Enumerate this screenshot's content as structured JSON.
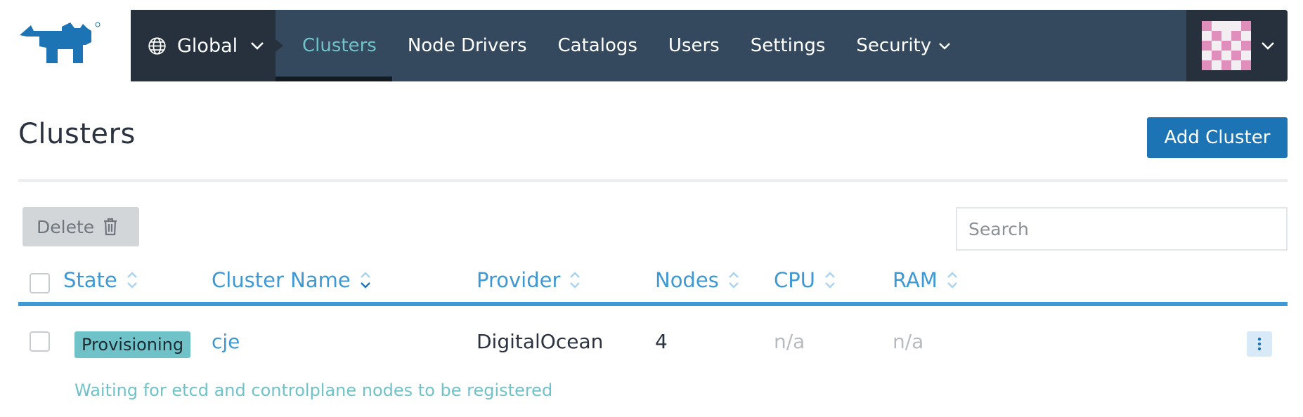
{
  "brand": {
    "logo_icon": "rancher-cow-logo",
    "logo_color": "#1d74b5"
  },
  "nav": {
    "scope_label": "Global",
    "items": [
      {
        "label": "Clusters",
        "active": true
      },
      {
        "label": "Node Drivers"
      },
      {
        "label": "Catalogs"
      },
      {
        "label": "Users"
      },
      {
        "label": "Settings"
      },
      {
        "label": "Security",
        "has_dropdown": true
      }
    ]
  },
  "page": {
    "title": "Clusters",
    "add_button_label": "Add Cluster"
  },
  "toolbar": {
    "delete_label": "Delete",
    "search_placeholder": "Search"
  },
  "table": {
    "columns": [
      "State",
      "Cluster Name",
      "Provider",
      "Nodes",
      "CPU",
      "RAM"
    ],
    "rows": [
      {
        "state": "Provisioning",
        "name": "cje",
        "provider": "DigitalOcean",
        "nodes": "4",
        "cpu": "n/a",
        "ram": "n/a",
        "message": "Waiting for etcd and controlplane nodes to be registered"
      }
    ]
  },
  "colors": {
    "nav_bg": "#34495e",
    "nav_dark": "#26313d",
    "accent_teal": "#6fc3c8",
    "primary_blue": "#1d74b5",
    "link_blue": "#3d98d3"
  }
}
